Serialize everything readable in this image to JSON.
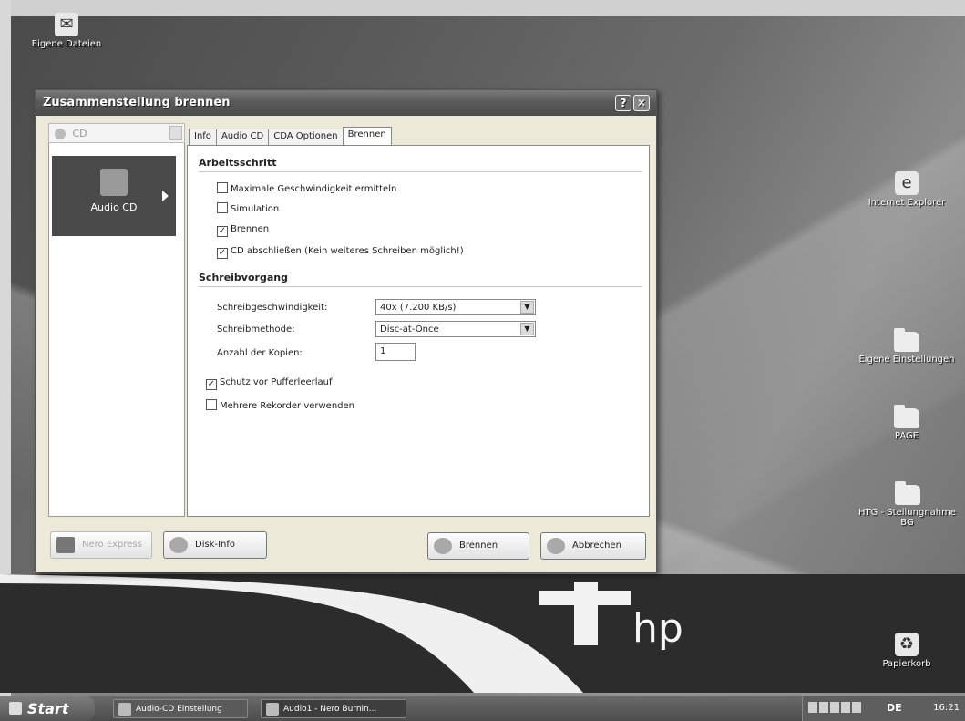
{
  "desktop": {
    "icons": {
      "email": "Eigene Dateien",
      "explorer": "Internet Explorer",
      "folder1": "Eigene Einstellungen",
      "folder2": "PAGE",
      "folder3": "HTG - Stellungnahme",
      "folder3b": "BG",
      "recycle": "Papierkorb"
    },
    "brand": "hp"
  },
  "dialog": {
    "title": "Zusammenstellung brennen",
    "help": "?",
    "close": "✕",
    "recorder_placeholder": "CD",
    "project_tile": "Audio CD",
    "tabs": [
      "Info",
      "Audio CD",
      "CDA Optionen",
      "Brennen"
    ],
    "sections": {
      "step": {
        "title": "Arbeitsschritt",
        "options": [
          {
            "label": "Maximale Geschwindigkeit ermitteln",
            "checked": false
          },
          {
            "label": "Simulation",
            "checked": false
          },
          {
            "label": "Brennen",
            "checked": true
          },
          {
            "label": "CD abschließen (Kein weiteres Schreiben möglich!)",
            "checked": true
          }
        ]
      },
      "write": {
        "title": "Schreibvorgang",
        "speed_label": "Schreibgeschwindigkeit:",
        "speed_value": "40x (7.200 KB/s)",
        "method_label": "Schreibmethode:",
        "method_value": "Disc-at-Once",
        "copies_label": "Anzahl der Kopien:",
        "copies_value": "1",
        "options": [
          {
            "label": "Schutz vor Pufferleerlauf",
            "checked": true
          },
          {
            "label": "Mehrere Rekorder verwenden",
            "checked": false
          }
        ]
      }
    },
    "buttons": {
      "nero_express": "Nero Express",
      "disk_info": "Disk-Info",
      "burn": "Brennen",
      "cancel": "Abbrechen"
    }
  },
  "taskbar": {
    "start": "Start",
    "tasks": [
      "Audio-CD Einstellung",
      "Audio1 - Nero Burnin..."
    ],
    "language": "DE",
    "clock": "16:21"
  }
}
